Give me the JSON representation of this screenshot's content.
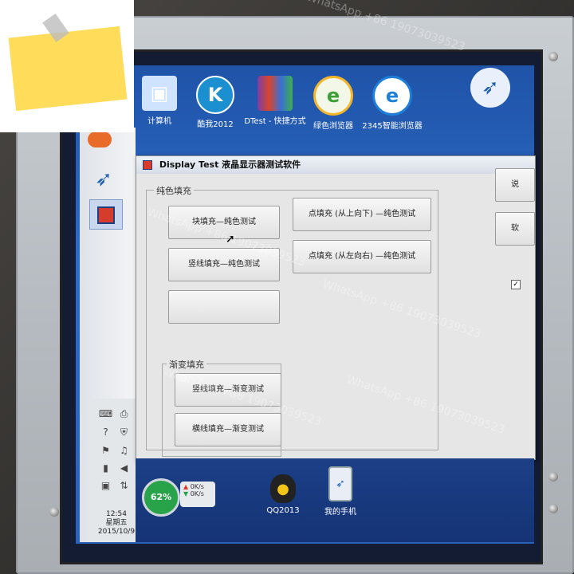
{
  "desktop": {
    "icons": [
      {
        "label": "计算机",
        "icon": "computer-icon"
      },
      {
        "label": "酷我2012",
        "icon": "kuwo-icon",
        "glyph": "K"
      },
      {
        "label": "DTest - 快捷方式",
        "icon": "winrar-icon"
      },
      {
        "label": "绿色浏览器",
        "icon": "ie-browser-icon",
        "glyph": "e"
      },
      {
        "label": "2345智能浏览器",
        "icon": "2345-browser-icon",
        "glyph": "e"
      }
    ]
  },
  "window": {
    "title": "Display Test 液晶显示器测试软件",
    "groups": [
      {
        "label": "纯色填充"
      },
      {
        "label": "渐变填充"
      }
    ],
    "buttons": {
      "block_fill": "块填充—纯色测试",
      "point_fill_top_down": "点填充 (从上向下) —纯色测试",
      "vertical_line_fill": "竖线填充—纯色测试",
      "point_fill_left_right": "点填充 (从左向右) —纯色测试",
      "faded_button": "    ",
      "gradient_vertical": "竖线填充—渐变测试",
      "gradient_horizontal": "横线填充—渐变测试"
    },
    "right_partial": [
      "说",
      "软"
    ]
  },
  "tray": {
    "clock_time": "12:54",
    "clock_day": "星期五",
    "clock_date": "2015/10/9",
    "cpu_percent": "62%",
    "net_up": "0K/s",
    "net_down": "0K/s"
  },
  "taskbar_bottom": {
    "qq_label": "QQ2013",
    "phone_label": "我的手机"
  },
  "watermark": "WhatsApp +86 19073039523",
  "colors": {
    "desktop": "#2a62bb",
    "sticky_note": "#ffdc5a",
    "dialog_bg": "#e6e6e6"
  }
}
